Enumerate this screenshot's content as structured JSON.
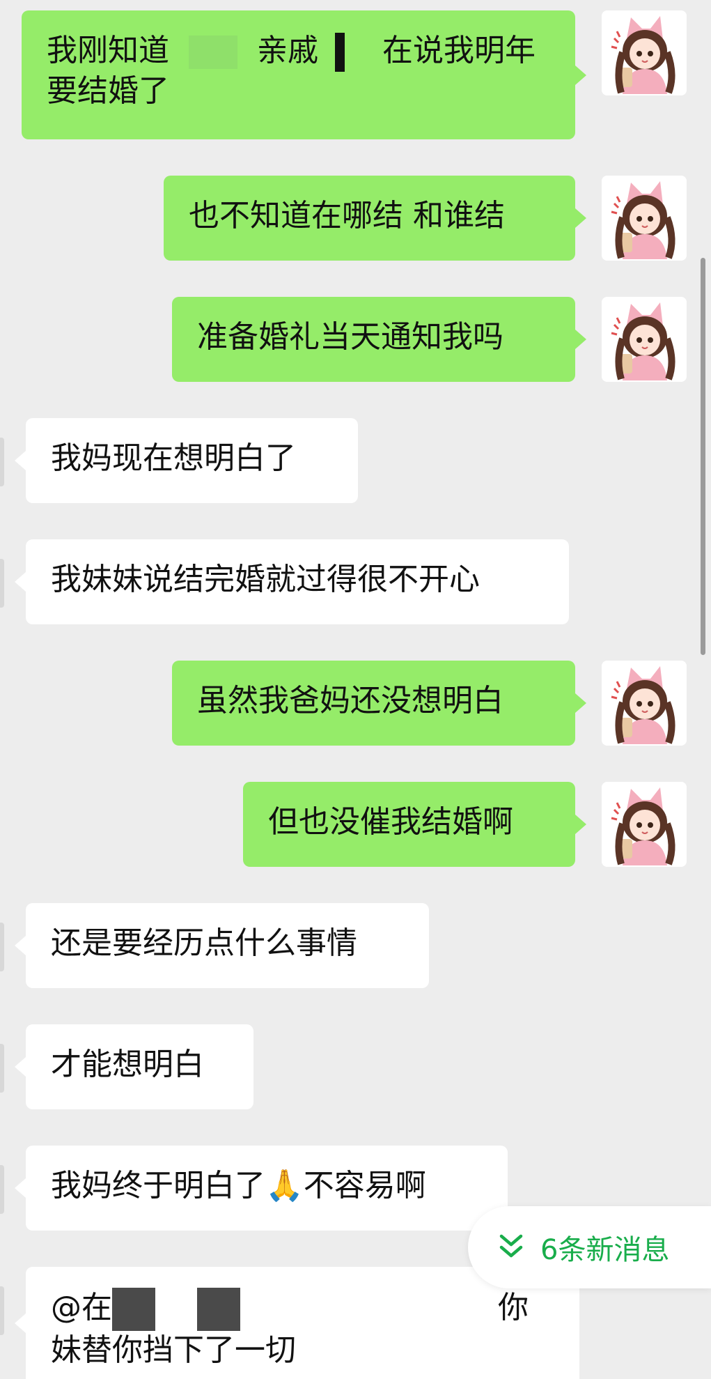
{
  "colors": {
    "outgoing_bubble": "#95ec69",
    "incoming_bubble": "#ffffff",
    "background": "#ededed",
    "accent": "#19ad4b"
  },
  "messages": [
    {
      "direction": "out",
      "line1_a": "我刚知道",
      "line1_b": "亲戚",
      "line1_c": "在说我明年",
      "line2": "要结婚了"
    },
    {
      "direction": "out",
      "text": "也不知道在哪结 和谁结"
    },
    {
      "direction": "out",
      "text": "准备婚礼当天通知我吗"
    },
    {
      "direction": "in",
      "text": "我妈现在想明白了"
    },
    {
      "direction": "in",
      "text": "我妹妹说结完婚就过得很不开心"
    },
    {
      "direction": "out",
      "text": "虽然我爸妈还没想明白"
    },
    {
      "direction": "out",
      "text": "但也没催我结婚啊"
    },
    {
      "direction": "in",
      "text": "还是要经历点什么事情"
    },
    {
      "direction": "in",
      "text": "才能想明白"
    },
    {
      "direction": "in",
      "text_a": "我妈终于明白了",
      "emoji": "🙏",
      "text_b": "不容易啊"
    },
    {
      "direction": "in",
      "line1_a": "@在",
      "line1_b": "你",
      "line2": "妹替你挡下了一切"
    }
  ],
  "avatar_icon": "anime-girl-fox-hood-avatar",
  "new_messages_pill": {
    "icon": "double-chevron-down-icon",
    "label": "6条新消息"
  }
}
